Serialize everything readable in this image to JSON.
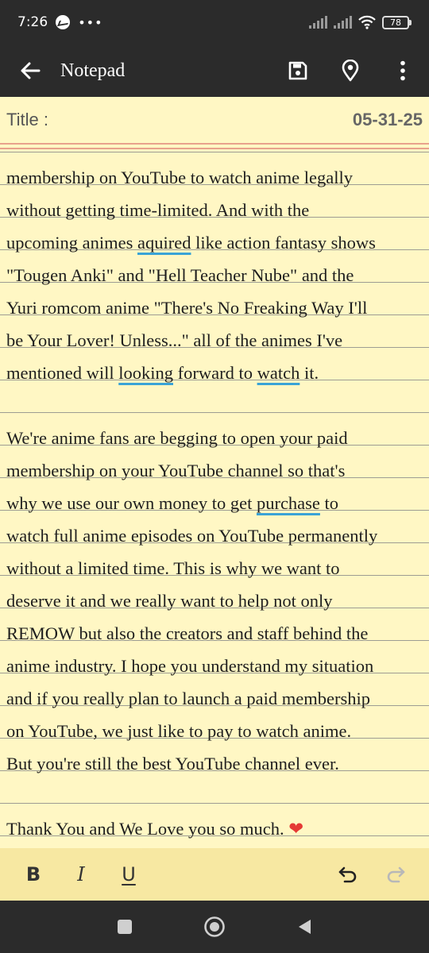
{
  "status_bar": {
    "time": "7:26",
    "dots": "•••",
    "battery": "78"
  },
  "app_bar": {
    "title": "Notepad"
  },
  "note": {
    "title_label": "Title :",
    "date": "05-31-25",
    "lines": [
      [
        {
          "t": "membership on YouTube to watch anime legally"
        }
      ],
      [
        {
          "t": "without getting time-limited. And with the"
        }
      ],
      [
        {
          "t": "upcoming animes "
        },
        {
          "t": "aquired",
          "sp": true
        },
        {
          "t": " like action fantasy shows"
        }
      ],
      [
        {
          "t": "\"Tougen Anki\" and \"Hell Teacher Nube\" and the"
        }
      ],
      [
        {
          "t": "Yuri romcom anime \"There's No Freaking Way I'll"
        }
      ],
      [
        {
          "t": "be Your Lover! Unless...\" all of the animes I've"
        }
      ],
      [
        {
          "t": "mentioned will "
        },
        {
          "t": "looking",
          "sp": true
        },
        {
          "t": " forward to "
        },
        {
          "t": "watch",
          "sp": true
        },
        {
          "t": " it."
        }
      ],
      [],
      [
        {
          "t": "We're anime fans are begging to open your paid"
        }
      ],
      [
        {
          "t": "membership on your YouTube channel so that's"
        }
      ],
      [
        {
          "t": "why we use our own money to get "
        },
        {
          "t": "purchase",
          "sp": true
        },
        {
          "t": " to"
        }
      ],
      [
        {
          "t": "watch full anime episodes on YouTube permanently"
        }
      ],
      [
        {
          "t": "without a limited time. This is why we want to"
        }
      ],
      [
        {
          "t": "deserve it and we really want to help not only"
        }
      ],
      [
        {
          "t": "REMOW but also the creators and staff behind the"
        }
      ],
      [
        {
          "t": "anime industry. I hope you understand my situation"
        }
      ],
      [
        {
          "t": "and if you really plan to launch a paid membership"
        }
      ],
      [
        {
          "t": "on YouTube, we just like to pay to watch anime."
        }
      ],
      [
        {
          "t": "But you're still the best YouTube channel ever."
        }
      ],
      [],
      [
        {
          "t": "Thank You and We Love you so much. "
        },
        {
          "t": "❤",
          "heart": true
        }
      ]
    ]
  },
  "format_bar": {
    "bold": "B",
    "italic": "I",
    "underline": "U"
  },
  "icons": {
    "back": "arrow-left-icon",
    "save": "save-icon",
    "location": "location-pin-icon",
    "menu": "more-vert-icon",
    "undo": "undo-icon",
    "redo": "redo-icon"
  },
  "colors": {
    "bar": "#2b2b2b",
    "paper": "#fff7c4",
    "format_bar": "#f7e8a2",
    "spell": "#3aa3d6",
    "heart": "#e53935"
  }
}
